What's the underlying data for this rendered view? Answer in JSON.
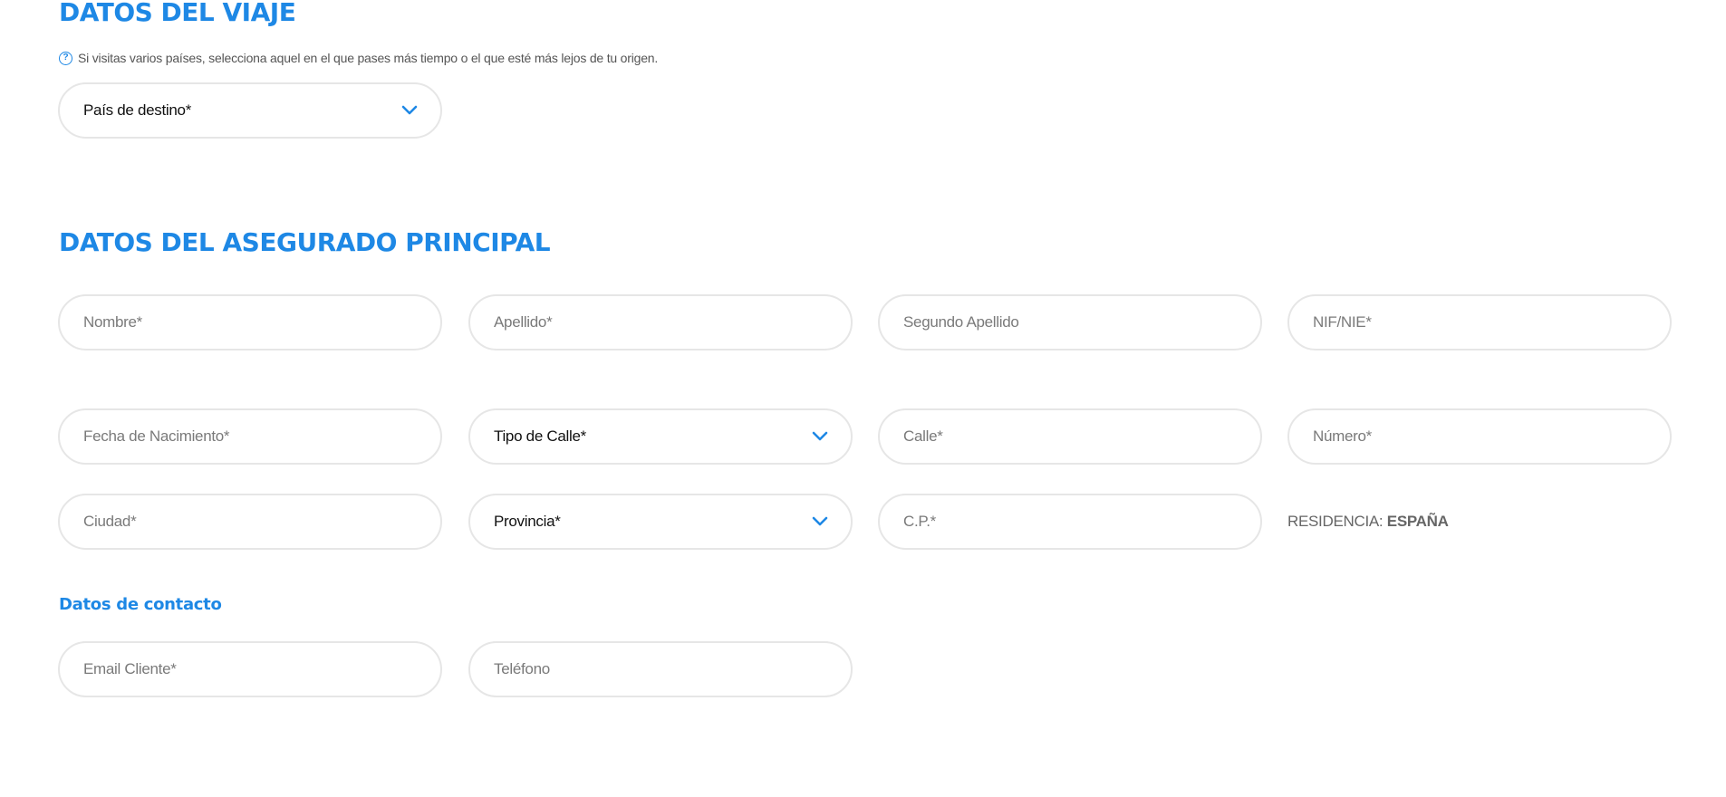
{
  "travel": {
    "title": "DATOS DEL VIAJE",
    "hint": "Si visitas varios países, selecciona aquel en el que pases más tiempo o el que esté más lejos de tu origen.",
    "destination": "País de destino*"
  },
  "insured": {
    "title": "DATOS DEL ASEGURADO PRINCIPAL",
    "first_name": "Nombre*",
    "last_name": "Apellido*",
    "second_last_name": "Segundo Apellido",
    "nif": "NIF/NIE*",
    "birth_date": "Fecha de Nacimiento*",
    "street_type": "Tipo de Calle*",
    "street": "Calle*",
    "number": "Número*",
    "city": "Ciudad*",
    "province": "Provincia*",
    "postal_code": "C.P.*",
    "residence_label": "RESIDENCIA:",
    "residence_value": "ESPAÑA"
  },
  "contact": {
    "title": "Datos de contacto",
    "email": "Email Cliente*",
    "phone": "Teléfono"
  },
  "colors": {
    "accent": "#1e88e5",
    "field_border": "#e6e6e6",
    "placeholder": "#7a7a7a"
  }
}
